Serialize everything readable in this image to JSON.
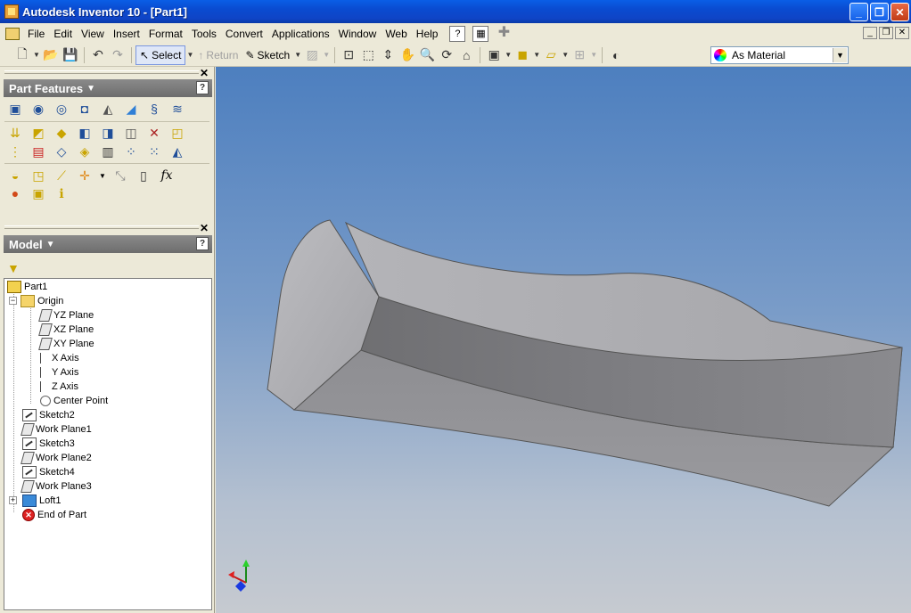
{
  "window": {
    "title": "Autodesk Inventor 10 - [Part1]"
  },
  "menu": {
    "items": [
      "File",
      "Edit",
      "View",
      "Insert",
      "Format",
      "Tools",
      "Convert",
      "Applications",
      "Window",
      "Web",
      "Help"
    ]
  },
  "toolbar": {
    "select_label": "Select",
    "return_label": "Return",
    "sketch_label": "Sketch",
    "appearance_value": "As Material"
  },
  "panels": {
    "features_title": "Part Features",
    "model_title": "Model",
    "function_glyph": "fx"
  },
  "tree": {
    "root": "Part1",
    "origin": "Origin",
    "origin_items": [
      "YZ Plane",
      "XZ Plane",
      "XY Plane",
      "X Axis",
      "Y Axis",
      "Z Axis",
      "Center Point"
    ],
    "features": [
      "Sketch2",
      "Work Plane1",
      "Sketch3",
      "Work Plane2",
      "Sketch4",
      "Work Plane3",
      "Loft1",
      "End of Part"
    ]
  },
  "icons": {
    "window_controls": [
      "minimize-icon",
      "restore-icon",
      "close-icon"
    ],
    "colors": {
      "title_blue": "#0a4bd0",
      "viewport_top": "#4d7fbf",
      "viewport_bottom": "#c6cad0",
      "part_gray": "#a3a3a6"
    }
  }
}
